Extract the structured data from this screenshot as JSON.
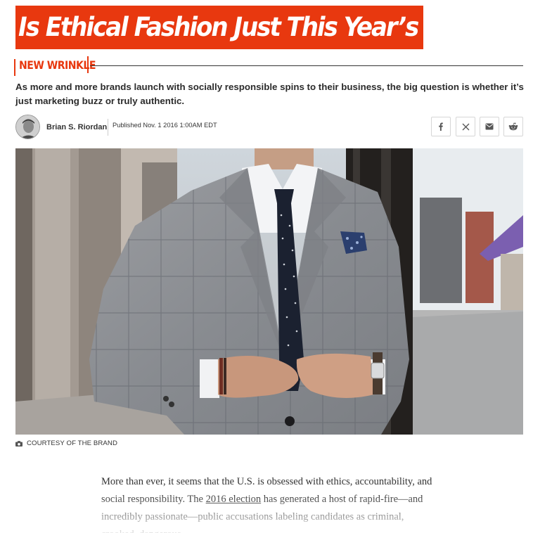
{
  "article": {
    "headline": "Is Ethical Fashion Just This Year’s Model?",
    "rubric": "NEW WRINKLE",
    "dek": "As more and more brands launch with socially responsible spins to their business, the big question is whether it’s just marketing buzz or truly authentic.",
    "byline": {
      "author": "Brian S. Riordan",
      "published": "Published Nov. 1 2016 1:00AM EDT"
    },
    "share": {
      "facebook_icon": "facebook-icon",
      "x_icon": "x-icon",
      "email_icon": "email-icon",
      "reddit_icon": "reddit-icon"
    },
    "photo": {
      "caption": "COURTESY OF THE BRAND",
      "caption_icon": "camera-icon"
    },
    "body": {
      "para1_before_link": "More than ever, it seems that the U.S. is obsessed with ethics, accountability, and social responsibility. The ",
      "para1_link": "2016 election",
      "para1_after_link": " has generated a host of rapid-fire—and incredibly passionate—public accusations labeling candidates as criminal, crooked, dangerous,"
    }
  },
  "colors": {
    "accent": "#e8380f",
    "headline_text": "#ffffff"
  }
}
